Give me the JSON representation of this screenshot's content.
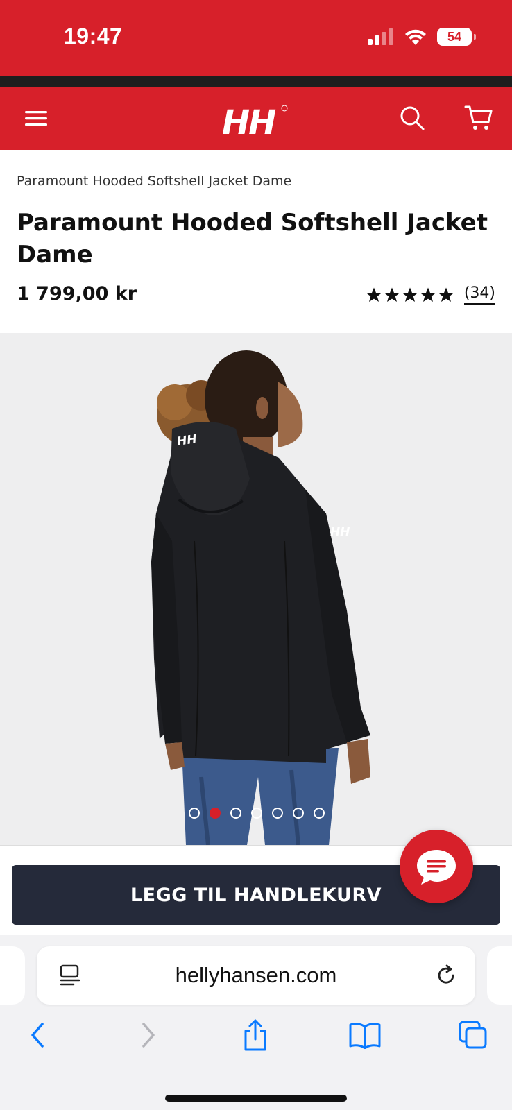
{
  "status_bar": {
    "time": "19:47",
    "battery": "54"
  },
  "header": {
    "logo_text": "HH",
    "brand_color": "#d7202a"
  },
  "product": {
    "breadcrumb": "Paramount Hooded Softshell Jacket Dame",
    "title": "Paramount Hooded Softshell Jacket Dame",
    "price": "1 799,00 kr",
    "rating_stars": 5,
    "review_count": "(34)"
  },
  "gallery": {
    "image_count": 7,
    "active_index": 1,
    "jacket_logo": "HH"
  },
  "cta": {
    "add_to_cart_label": "LEGG TIL HANDLEKURV"
  },
  "browser": {
    "url": "hellyhansen.com",
    "accent_color": "#0a7aff"
  }
}
